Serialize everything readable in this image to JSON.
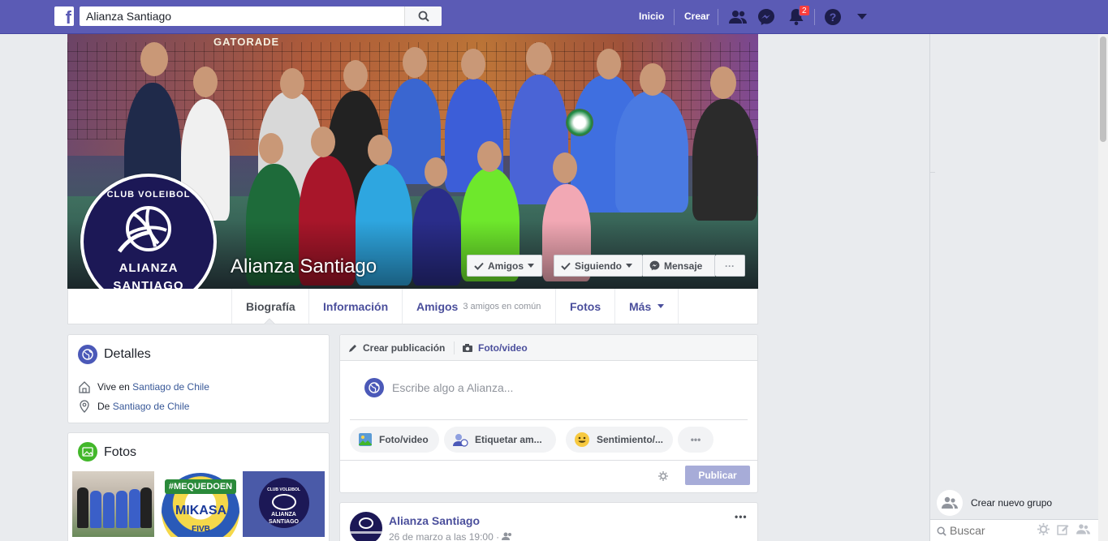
{
  "topbar": {
    "logo": "f",
    "search_value": "Alianza Santiago",
    "nav": {
      "home": "Inicio",
      "create": "Crear"
    },
    "notifications_count": "2"
  },
  "cover": {
    "wall_text": "GATORADE",
    "page_name": "Alianza Santiago",
    "buttons": {
      "friends": "Amigos",
      "following": "Siguiendo",
      "message": "Mensaje",
      "more": "···"
    }
  },
  "avatar": {
    "top_text": "CLUB VOLEIBOL",
    "name_line1": "ALIANZA",
    "name_line2": "SANTIAGO"
  },
  "tabs": {
    "bio": "Biografía",
    "info": "Información",
    "friends": "Amigos",
    "friends_sub": "3 amigos en común",
    "photos": "Fotos",
    "more": "Más"
  },
  "details": {
    "title": "Detalles",
    "lives_prefix": "Vive en",
    "lives_link": "Santiago de Chile",
    "from_prefix": "De",
    "from_link": "Santiago de Chile"
  },
  "photos_card": {
    "title": "Fotos",
    "photo2_banner": "#MEQUEDOEN",
    "photo2_brand": "MIKASA",
    "photo2_sub": "FIVB",
    "photo3_top": "CLUB VOLEIBOL",
    "photo3_name1": "ALIANZA",
    "photo3_name2": "SANTIAGO"
  },
  "composer": {
    "create_post": "Crear publicación",
    "photo_video_tab": "Foto/video",
    "placeholder": "Escribe algo a Alianza...",
    "actions": {
      "photo": "Foto/video",
      "tag": "Etiquetar am...",
      "feeling": "Sentimiento/...",
      "more": "•••"
    },
    "publish": "Publicar"
  },
  "post": {
    "author": "Alianza Santiago",
    "date": "26 de marzo a las 19:00 ·",
    "menu": "•••"
  },
  "chat": {
    "create_group": "Crear nuevo grupo",
    "search_placeholder": "Buscar"
  }
}
